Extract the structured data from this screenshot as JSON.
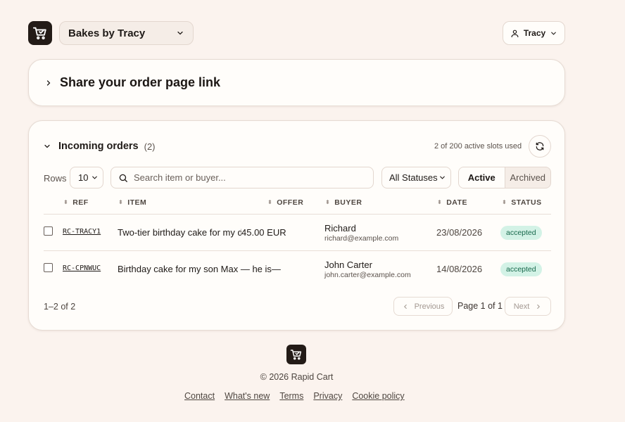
{
  "header": {
    "store_name": "Bakes by Tracy",
    "user_name": "Tracy"
  },
  "share": {
    "title": "Share your order page link"
  },
  "orders": {
    "title": "Incoming orders",
    "count": "(2)",
    "slots_text": "2 of 200 active slots used",
    "rows_label": "Rows",
    "rows_value": "10",
    "search_placeholder": "Search item or buyer...",
    "status_filter": "All Statuses",
    "tabs": [
      "Active",
      "Archived"
    ],
    "columns": [
      "REF",
      "ITEM",
      "OFFER",
      "BUYER",
      "DATE",
      "STATUS"
    ],
    "rows": [
      {
        "ref": "RC-TRACY1",
        "item": "Two-tier birthday cake for my daughter",
        "offer": "45.00 EUR",
        "buyer_name": "Richard",
        "buyer_email": "richard@example.com",
        "date": "23/08/2026",
        "status": "accepted"
      },
      {
        "ref": "RC-CPNWUC",
        "item": "Birthday cake for my son Max — he is—",
        "offer": "",
        "buyer_name": "John Carter",
        "buyer_email": "john.carter@example.com",
        "date": "14/08/2026",
        "status": "accepted"
      }
    ],
    "range": "1–2 of 2",
    "prev_label": "Previous",
    "page_info": "Page 1 of 1",
    "next_label": "Next"
  },
  "footer": {
    "copyright": "© 2026 Rapid Cart",
    "links": [
      "Contact",
      "What's new",
      "Terms",
      "Privacy",
      "Cookie policy"
    ]
  },
  "colors": {
    "background": "#fbf3ee",
    "logo": "#231b17",
    "badge_bg": "#d3f2e6",
    "badge_text": "#16684b"
  },
  "icons": {
    "logo": "cart-icon",
    "chevron": "chevron-down-icon",
    "user": "user-icon",
    "refresh": "refresh-icon",
    "search": "search-icon"
  }
}
